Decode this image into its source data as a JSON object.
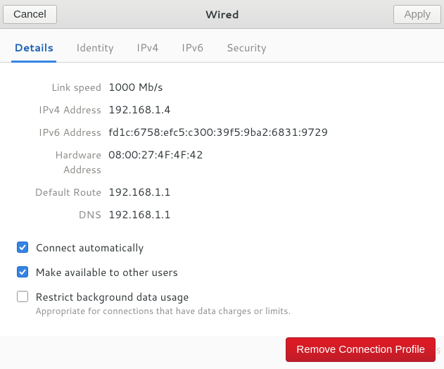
{
  "header": {
    "cancel": "Cancel",
    "title": "Wired",
    "apply": "Apply"
  },
  "tabs": [
    {
      "id": "details",
      "label": "Details",
      "active": true
    },
    {
      "id": "identity",
      "label": "Identity",
      "active": false
    },
    {
      "id": "ipv4",
      "label": "IPv4",
      "active": false
    },
    {
      "id": "ipv6",
      "label": "IPv6",
      "active": false
    },
    {
      "id": "security",
      "label": "Security",
      "active": false
    }
  ],
  "details": {
    "link_speed": {
      "label": "Link speed",
      "value": "1000 Mb/s"
    },
    "ipv4": {
      "label": "IPv4 Address",
      "value": "192.168.1.4"
    },
    "ipv6": {
      "label": "IPv6 Address",
      "value": "fd1c:6758:efc5:c300:39f5:9ba2:6831:9729"
    },
    "hw": {
      "label": "Hardware Address",
      "value": "08:00:27:4F:4F:42"
    },
    "route": {
      "label": "Default Route",
      "value": "192.168.1.1"
    },
    "dns": {
      "label": "DNS",
      "value": "192.168.1.1"
    }
  },
  "options": {
    "auto": {
      "label": "Connect automatically",
      "checked": true
    },
    "share": {
      "label": "Make available to other users",
      "checked": true
    },
    "bg": {
      "label": "Restrict background data usage",
      "sub": "Appropriate for connections that have data charges or limits.",
      "checked": false
    }
  },
  "footer": {
    "remove": "Remove Connection Profile"
  },
  "watermark": "FOSS"
}
